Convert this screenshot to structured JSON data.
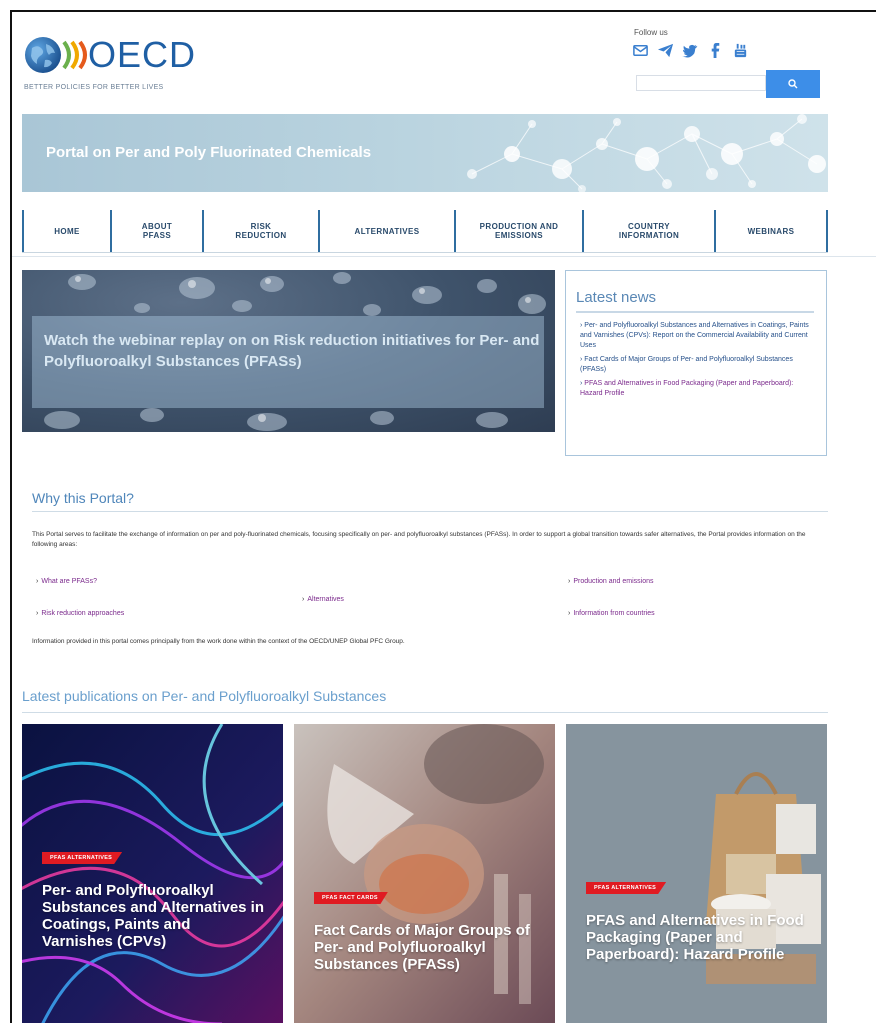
{
  "header": {
    "logo_text": "OECD",
    "tagline": "BETTER POLICIES FOR BETTER LIVES",
    "follow_label": "Follow us",
    "social_icons": [
      "email-icon",
      "telegram-icon",
      "twitter-icon",
      "facebook-icon",
      "youtube-icon"
    ],
    "search": {
      "placeholder": "",
      "button_icon": "search-icon"
    }
  },
  "banner": {
    "title": "Portal on Per and Poly Fluorinated Chemicals"
  },
  "nav": {
    "items": [
      "HOME",
      "ABOUT PFASS",
      "RISK REDUCTION",
      "ALTERNATIVES",
      "PRODUCTION AND EMISSIONS",
      "COUNTRY INFORMATION",
      "WEBINARS"
    ]
  },
  "hero": {
    "text": "Watch the webinar replay on on Risk reduction initiatives for Per- and Polyfluoroalkyl Substances (PFASs)"
  },
  "latest_news": {
    "title": "Latest news",
    "items": [
      "Per- and Polyfluoroalkyl Substances and Alternatives in Coatings, Paints and Varnishes (CPVs): Report on the Commercial Availability and Current Uses",
      "Fact Cards of Major Groups of Per- and Polyfluoroalkyl Substances (PFASs)",
      "PFAS and Alternatives in Food Packaging (Paper and Paperboard): Hazard Profile"
    ]
  },
  "why": {
    "title": "Why this Portal?",
    "intro": "This Portal serves to facilitate the exchange of information on per and poly-fluorinated chemicals, focusing specifically on per- and polyfluoroalkyl substances (PFASs). In order to support a global transition towards safer alternatives, the Portal provides information on the following areas:",
    "links": [
      "What are PFASs?",
      "Risk reduction approaches",
      "Alternatives",
      "Production and emissions",
      "Information from countries"
    ],
    "footer": "Information provided in this portal comes principally from the work done within the context of the OECD/UNEP Global PFC Group."
  },
  "publications": {
    "title": "Latest publications on Per- and Polyfluoroalkyl Substances",
    "cards": [
      {
        "badge": "PFAS ALTERNATIVES",
        "title": "Per- and Polyfluoroalkyl Substances and Alternatives in Coatings, Paints and Varnishes (CPVs)"
      },
      {
        "badge": "PFAS FACT CARDS",
        "title": "Fact Cards of Major Groups of Per- and Polyfluoroalkyl Substances (PFASs)"
      },
      {
        "badge": "PFAS ALTERNATIVES",
        "title": "PFAS and Alternatives in Food Packaging (Paper and Paperboard): Hazard Profile"
      }
    ]
  },
  "colors": {
    "brand_blue": "#1f5fa4",
    "link_purple": "#7b2a8c",
    "news_blue": "#26508a",
    "badge_red": "#e01b22",
    "search_button": "#3d8ee8"
  }
}
